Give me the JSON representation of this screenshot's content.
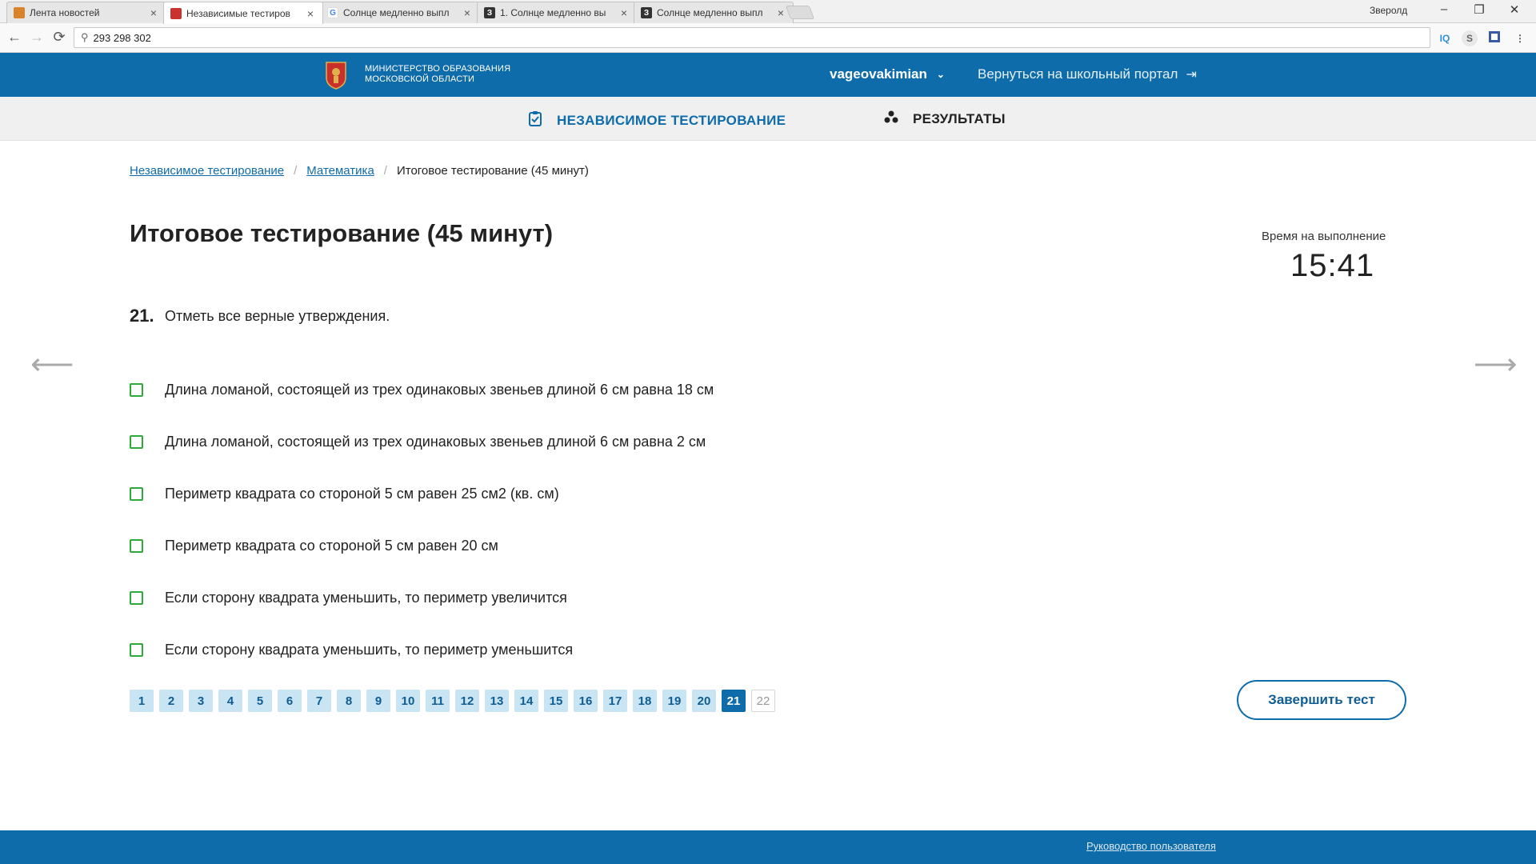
{
  "browser": {
    "tabs": [
      {
        "title": "Лента новостей",
        "favicon_color": "#d9842a",
        "active": false
      },
      {
        "title": "Независимые тестиров",
        "favicon_color": "#c9322e",
        "active": true
      },
      {
        "title": "Солнце медленно выпл",
        "favicon_color": "#4285f4",
        "active": false
      },
      {
        "title": "1. Солнце медленно вы",
        "favicon_color": "#333333",
        "active": false
      },
      {
        "title": "Солнце медленно выпл",
        "favicon_color": "#333333",
        "active": false
      }
    ],
    "profile_name": "Зверолд",
    "address": "293 298 302",
    "controls": {
      "minimize": "–",
      "restore": "❐",
      "close": "✕"
    },
    "extensions": [
      "IQ",
      "S"
    ]
  },
  "header": {
    "ministry_line1": "МИНИСТЕРСТВО ОБРАЗОВАНИЯ",
    "ministry_line2": "МОСКОВСКОЙ ОБЛАСТИ",
    "username": "vageovakimian",
    "back_portal": "Вернуться на школьный портал",
    "brand_color": "#0f6cab"
  },
  "subnav": {
    "testing": "НЕЗАВИСИМОЕ ТЕСТИРОВАНИЕ",
    "results": "РЕЗУЛЬТАТЫ"
  },
  "breadcrumb": {
    "item1": "Независимое тестирование",
    "item2": "Математика",
    "current": "Итоговое тестирование (45 минут)"
  },
  "page": {
    "title": "Итоговое тестирование (45 минут)",
    "timer_label": "Время на выполнение",
    "timer_value": "15:41"
  },
  "question": {
    "number": "21.",
    "text": "Отметь все верные утверждения.",
    "options": [
      "Длина ломаной, состоящей из трех одинаковых звеньев длиной 6 см равна 18 см",
      "Длина ломаной, состоящей из трех одинаковых звеньев длиной 6 см равна 2 см",
      "Периметр квадрата со стороной 5 см равен 25 см2 (кв. см)",
      "Периметр квадрата со стороной 5 см равен 20 см",
      "Если сторону квадрата уменьшить, то периметр увеличится",
      "Если сторону квадрата уменьшить, то периметр уменьшится"
    ]
  },
  "pager": {
    "pages": [
      "1",
      "2",
      "3",
      "4",
      "5",
      "6",
      "7",
      "8",
      "9",
      "10",
      "11",
      "12",
      "13",
      "14",
      "15",
      "16",
      "17",
      "18",
      "19",
      "20",
      "21",
      "22"
    ],
    "current": "21",
    "unanswered": "22"
  },
  "finish_label": "Завершить тест",
  "footer": {
    "guide": "Руководство пользователя"
  },
  "icons": {
    "back": "back-arrow-icon",
    "forward": "forward-arrow-icon",
    "reload": "reload-icon"
  }
}
